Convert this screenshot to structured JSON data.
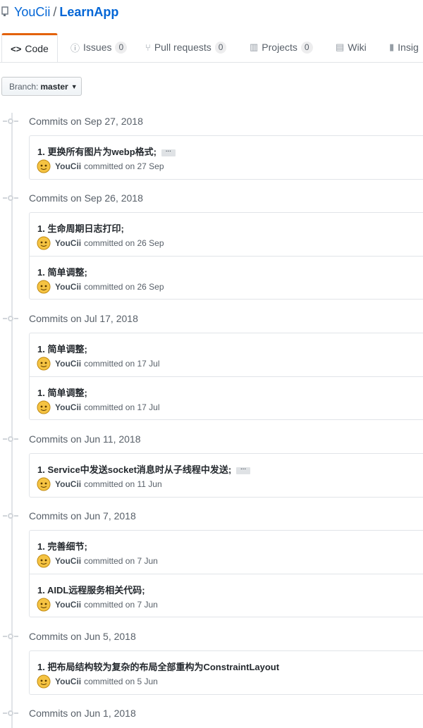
{
  "repo": {
    "owner": "YouCii",
    "separator": "/",
    "name": "LearnApp"
  },
  "tabs": [
    {
      "id": "code",
      "label": "Code",
      "icon": "code-icon"
    },
    {
      "id": "issues",
      "label": "Issues",
      "count": "0",
      "icon": "issue-icon"
    },
    {
      "id": "pulls",
      "label": "Pull requests",
      "count": "0",
      "icon": "pull-request-icon"
    },
    {
      "id": "projects",
      "label": "Projects",
      "count": "0",
      "icon": "project-icon"
    },
    {
      "id": "wiki",
      "label": "Wiki",
      "icon": "book-icon"
    },
    {
      "id": "insights",
      "label": "Insig",
      "icon": "graph-icon"
    }
  ],
  "branch": {
    "label": "Branch:",
    "value": "master"
  },
  "groups": [
    {
      "date": "Commits on Sep 27, 2018",
      "commits": [
        {
          "message": "1. 更换所有图片为webp格式;",
          "author": "YouCii",
          "action": "committed on 27 Sep",
          "has_more": true
        }
      ]
    },
    {
      "date": "Commits on Sep 26, 2018",
      "commits": [
        {
          "message": "1. 生命周期日志打印;",
          "author": "YouCii",
          "action": "committed on 26 Sep"
        },
        {
          "message": "1. 简单调整;",
          "author": "YouCii",
          "action": "committed on 26 Sep"
        }
      ]
    },
    {
      "date": "Commits on Jul 17, 2018",
      "commits": [
        {
          "message": "1. 简单调整;",
          "author": "YouCii",
          "action": "committed on 17 Jul"
        },
        {
          "message": "1. 简单调整;",
          "author": "YouCii",
          "action": "committed on 17 Jul"
        }
      ]
    },
    {
      "date": "Commits on Jun 11, 2018",
      "commits": [
        {
          "message": "1. Service中发送socket消息时从子线程中发送;",
          "author": "YouCii",
          "action": "committed on 11 Jun",
          "has_more": true
        }
      ]
    },
    {
      "date": "Commits on Jun 7, 2018",
      "commits": [
        {
          "message": "1. 完善细节;",
          "author": "YouCii",
          "action": "committed on 7 Jun"
        },
        {
          "message": "1. AIDL远程服务相关代码;",
          "author": "YouCii",
          "action": "committed on 7 Jun"
        }
      ]
    },
    {
      "date": "Commits on Jun 5, 2018",
      "commits": [
        {
          "message": "1. 把布局结构较为复杂的布局全部重构为ConstraintLayout",
          "author": "YouCii",
          "action": "committed on 5 Jun"
        }
      ]
    },
    {
      "date": "Commits on Jun 1, 2018",
      "commits": []
    }
  ],
  "colors": {
    "link": "#0366d6",
    "tab_accent": "#e36209",
    "border": "#e1e4e8",
    "muted": "#586069"
  }
}
